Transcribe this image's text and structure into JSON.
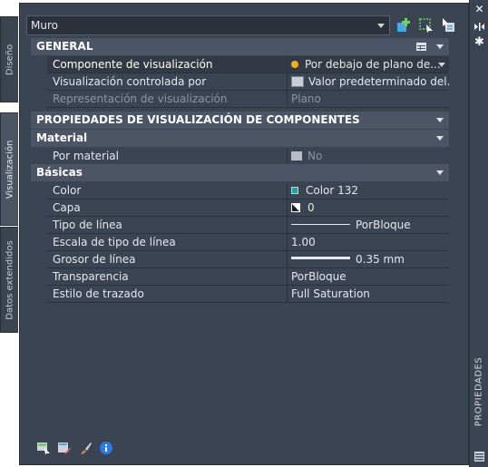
{
  "left_tabs": [
    {
      "label": "Diseño"
    },
    {
      "label": "Visualización"
    },
    {
      "label": "Datos extendidos"
    }
  ],
  "header": {
    "object_type": "Muro"
  },
  "right_bar": {
    "title": "PROPIEDADES"
  },
  "sections": {
    "general": {
      "title": "GENERAL"
    },
    "props": {
      "title": "PROPIEDADES DE VISUALIZACIÓN DE COMPONENTES"
    },
    "material": {
      "title": "Material"
    },
    "basicas": {
      "title": "Básicas"
    }
  },
  "general_rows": [
    {
      "label": "Componente de visualización",
      "value": "Por debajo de plano de..."
    },
    {
      "label": "Visualización controlada por",
      "value": "Valor predeterminado del..."
    },
    {
      "label": "Representación de visualización",
      "value": "Plano"
    }
  ],
  "material_rows": [
    {
      "label": "Por material",
      "value": "No"
    }
  ],
  "basicas_rows": [
    {
      "label": "Color",
      "value": "Color 132"
    },
    {
      "label": "Capa",
      "value": "0"
    },
    {
      "label": "Tipo de línea",
      "value": "PorBloque"
    },
    {
      "label": "Escala de tipo de línea",
      "value": "1.00"
    },
    {
      "label": "Grosor de línea",
      "value": "0.35 mm"
    },
    {
      "label": "Transparencia",
      "value": "PorBloque"
    },
    {
      "label": "Estilo de trazado",
      "value": "Full Saturation"
    }
  ],
  "colors": {
    "accent_color_swatch": "#1ca3a3",
    "panel_bg": "#3b4453",
    "section_bg": "#4b5565"
  }
}
